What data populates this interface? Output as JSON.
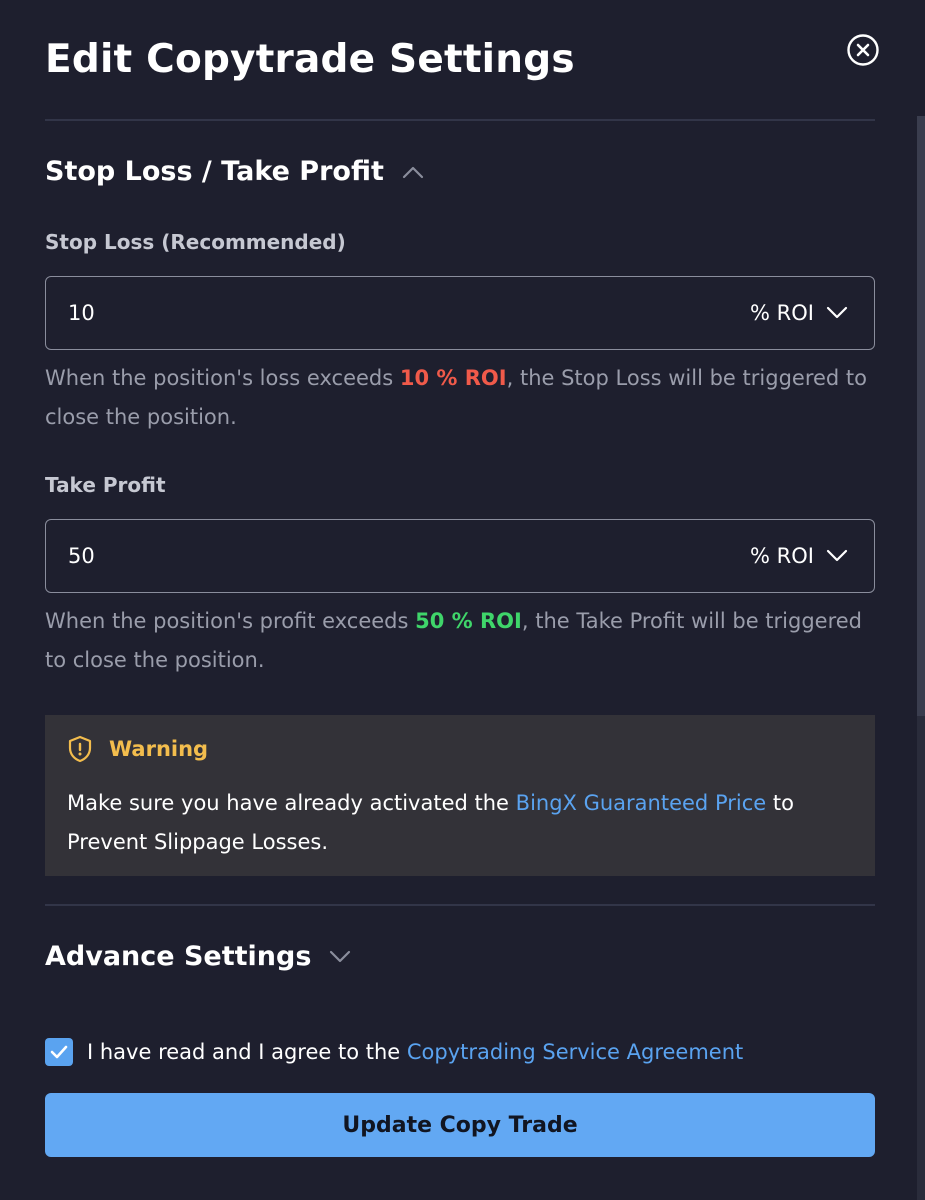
{
  "modal": {
    "title": "Edit Copytrade Settings"
  },
  "sl_tp_section": {
    "title": "Stop Loss / Take Profit",
    "expanded": true
  },
  "stop_loss": {
    "label": "Stop Loss (Recommended)",
    "value": "10",
    "unit": "% ROI",
    "help_before": "When the position's loss exceeds ",
    "help_highlight": "10 % ROI",
    "help_after": ", the Stop Loss will be triggered to close the position."
  },
  "take_profit": {
    "label": "Take Profit",
    "value": "50",
    "unit": "% ROI",
    "help_before": "When the position's profit exceeds ",
    "help_highlight": "50 % ROI",
    "help_after": ", the Take Profit will be triggered to close the position."
  },
  "warning": {
    "title": "Warning",
    "text_before": "Make sure you have already activated the ",
    "link": "BingX Guaranteed Price",
    "text_after": " to Prevent Slippage Losses."
  },
  "advance_section": {
    "title": "Advance Settings",
    "expanded": false
  },
  "agreement": {
    "checked": true,
    "text": "I have read and I agree to the ",
    "link": "Copytrading Service Agreement"
  },
  "actions": {
    "update_label": "Update Copy Trade"
  },
  "colors": {
    "background": "#1e1f2e",
    "accent": "#5aa3f0",
    "loss": "#f05a4a",
    "profit": "#3fd56a",
    "warning": "#f3bd4d"
  },
  "icons": {
    "close": "close-circle-icon",
    "expand_open": "chevron-up-icon",
    "expand_closed": "chevron-down-icon",
    "unit_dropdown": "chevron-down-icon",
    "warning": "shield-warning-icon",
    "checkbox": "check-icon"
  }
}
